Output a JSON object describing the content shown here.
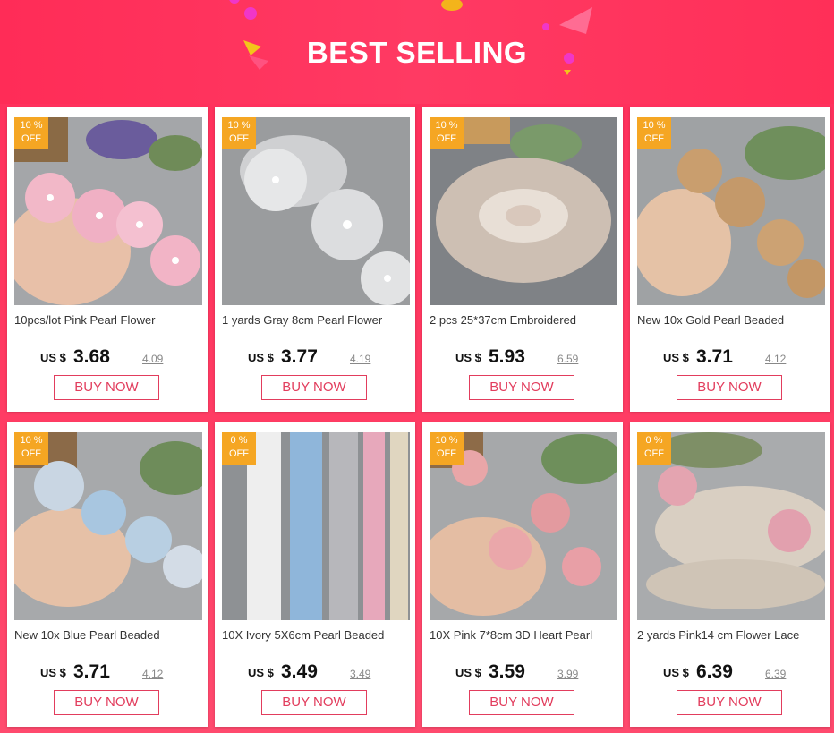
{
  "header": {
    "title": "BEST SELLING"
  },
  "colors": {
    "accent": "#ff2e5b",
    "badge": "#f5a623",
    "button_border": "#e23d5d"
  },
  "products": [
    {
      "badge_pct": "10 %",
      "badge_off": "OFF",
      "name": "10pcs/lot Pink Pearl Flower",
      "currency": "US $",
      "price": "3.68",
      "old_price": "4.09",
      "button": "BUY NOW",
      "image": "pink-flower-lace"
    },
    {
      "badge_pct": "10 %",
      "badge_off": "OFF",
      "name": "1 yards Gray 8cm Pearl Flower",
      "currency": "US $",
      "price": "3.77",
      "old_price": "4.19",
      "button": "BUY NOW",
      "image": "gray-flower-lace"
    },
    {
      "badge_pct": "10 %",
      "badge_off": "OFF",
      "name": "2 pcs 25*37cm Embroidered",
      "currency": "US $",
      "price": "5.93",
      "old_price": "6.59",
      "button": "BUY NOW",
      "image": "oval-doily"
    },
    {
      "badge_pct": "10 %",
      "badge_off": "OFF",
      "name": "New 10x Gold Pearl Beaded",
      "currency": "US $",
      "price": "3.71",
      "old_price": "4.12",
      "button": "BUY NOW",
      "image": "gold-beaded-lace"
    },
    {
      "badge_pct": "10 %",
      "badge_off": "OFF",
      "name": "New 10x Blue Pearl Beaded",
      "currency": "US $",
      "price": "3.71",
      "old_price": "4.12",
      "button": "BUY NOW",
      "image": "blue-beaded-lace"
    },
    {
      "badge_pct": "0 %",
      "badge_off": "OFF",
      "name": "10X Ivory 5X6cm Pearl Beaded",
      "currency": "US $",
      "price": "3.49",
      "old_price": "3.49",
      "button": "BUY NOW",
      "image": "color-strips-lace"
    },
    {
      "badge_pct": "10 %",
      "badge_off": "OFF",
      "name": "10X Pink 7*8cm 3D Heart Pearl",
      "currency": "US $",
      "price": "3.59",
      "old_price": "3.99",
      "button": "BUY NOW",
      "image": "pink-heart-lace"
    },
    {
      "badge_pct": "0 %",
      "badge_off": "OFF",
      "name": "2 yards Pink14 cm Flower Lace",
      "currency": "US $",
      "price": "6.39",
      "old_price": "6.39",
      "button": "BUY NOW",
      "image": "pink-net-lace"
    }
  ]
}
